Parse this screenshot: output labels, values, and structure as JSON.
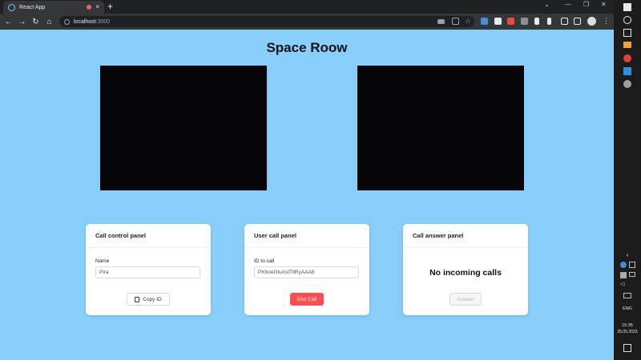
{
  "browser": {
    "tab_title": "React App",
    "url_host": "localhost:",
    "url_port": "3000",
    "new_tab": "+",
    "close": "×"
  },
  "page": {
    "title": "Space Roow"
  },
  "panels": {
    "call_control": {
      "title": "Call control panel",
      "name_label": "Name",
      "name_value": "Pira",
      "copy_button": "Copy ID"
    },
    "user_call": {
      "title": "User call panel",
      "id_label": "ID to call",
      "id_value": "PKhoeGluAstTllRyAAA8",
      "end_button": "End Call"
    },
    "call_answer": {
      "title": "Call answer panel",
      "status": "No incoming calls",
      "answer_button": "Answer"
    }
  },
  "taskbar": {
    "language": "ENG",
    "time": "15:35",
    "date": "25.05.2023"
  },
  "colors": {
    "page_bg": "#87cefa",
    "danger": "#ff4d4f",
    "video_bg": "#050409"
  }
}
